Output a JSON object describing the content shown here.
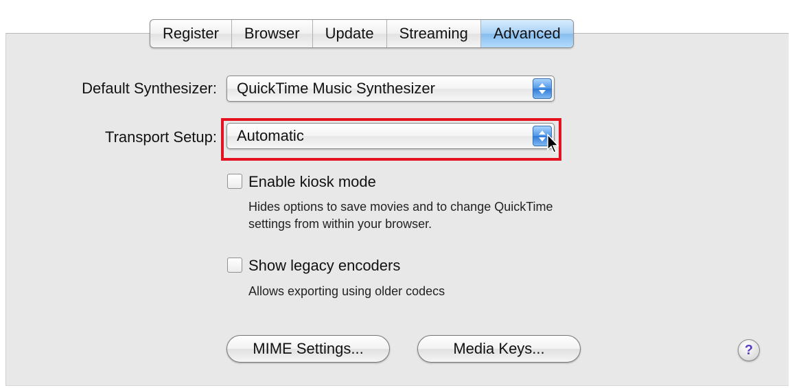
{
  "tabs": [
    {
      "label": "Register",
      "active": false
    },
    {
      "label": "Browser",
      "active": false
    },
    {
      "label": "Update",
      "active": false
    },
    {
      "label": "Streaming",
      "active": false
    },
    {
      "label": "Advanced",
      "active": true
    }
  ],
  "synth": {
    "label": "Default Synthesizer:",
    "value": "QuickTime Music Synthesizer",
    "icon": "popup-arrows-icon"
  },
  "transport": {
    "label": "Transport Setup:",
    "value": "Automatic",
    "icon": "popup-arrows-icon"
  },
  "kiosk": {
    "label": "Enable kiosk mode",
    "checked": false,
    "desc1": "Hides options to save movies and to change QuickTime",
    "desc2": "settings from within your browser."
  },
  "legacy": {
    "label": "Show legacy encoders",
    "checked": false,
    "desc": "Allows exporting using older codecs"
  },
  "buttons": {
    "mime": "MIME Settings...",
    "media_keys": "Media Keys..."
  },
  "help": {
    "glyph": "?",
    "icon": "help-icon"
  },
  "colors": {
    "accent": "#86bdee",
    "highlight": "#e3121e"
  }
}
